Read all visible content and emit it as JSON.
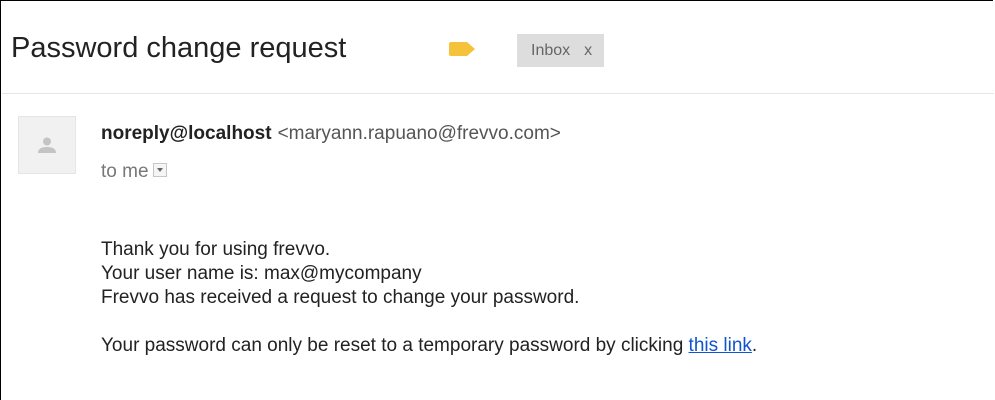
{
  "email": {
    "subject": "Password change request",
    "label_color": "#f5c33b",
    "label_chip": {
      "text": "Inbox",
      "remove": "x"
    },
    "sender": {
      "name": "noreply@localhost",
      "email": "<maryann.rapuano@frevvo.com>"
    },
    "recipient": "to me",
    "body": {
      "line1": "Thank you for using frevvo.",
      "line2": "Your user name is: max@mycompany",
      "line3": "Frevvo has received a request to change your password.",
      "line4_prefix": "Your password can only be reset to a temporary password by clicking ",
      "link_text": "this link",
      "line4_suffix": "."
    }
  },
  "icons": {
    "avatar": "person-icon",
    "label": "label-tag-icon",
    "dropdown": "chevron-down-icon"
  },
  "colors": {
    "link": "#1155cc",
    "chip_bg": "#dddddd"
  }
}
